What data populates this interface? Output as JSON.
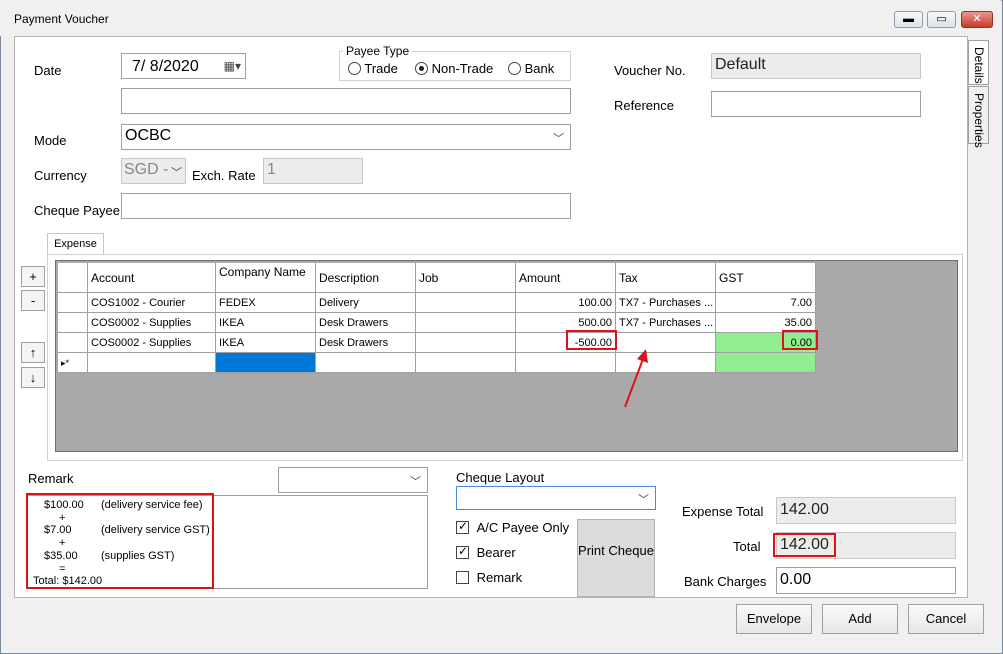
{
  "window": {
    "title": "Payment Voucher",
    "min_glyph": "▬",
    "max_glyph": "▭",
    "close_glyph": "✕"
  },
  "side_tabs": {
    "details": "Details",
    "properties": "Properties"
  },
  "form": {
    "date_label": "Date",
    "date_value": "7/  8/2020",
    "payee_type": {
      "legend": "Payee Type",
      "options": [
        "Trade",
        "Non-Trade",
        "Bank"
      ],
      "selected": "Non-Trade"
    },
    "voucher_label": "Voucher No.",
    "voucher_value": "Default",
    "reference_label": "Reference",
    "reference_value": "",
    "mode_label": "Mode",
    "mode_value": "OCBC",
    "currency_label": "Currency",
    "currency_value": "SGD -",
    "exch_label": "Exch. Rate",
    "exch_value": "1",
    "cheque_payee_label": "Cheque Payee",
    "cheque_payee_value": ""
  },
  "expense_tab": {
    "label": "Expense"
  },
  "side_buttons": {
    "add": "+",
    "remove": "-",
    "up": "↑",
    "down": "↓"
  },
  "grid": {
    "columns": [
      "Account",
      "Company Name",
      "Description",
      "Job",
      "Amount",
      "Tax",
      "GST"
    ],
    "rows": [
      {
        "account": "COS1002 - Courier",
        "company": "FEDEX",
        "description": "Delivery",
        "job": "",
        "amount": "100.00",
        "tax": "TX7 - Purchases ...",
        "gst": "7.00"
      },
      {
        "account": "COS0002 - Supplies",
        "company": "IKEA",
        "description": "Desk Drawers",
        "job": "",
        "amount": "500.00",
        "tax": "TX7 - Purchases ...",
        "gst": "35.00"
      },
      {
        "account": "COS0002 - Supplies",
        "company": "IKEA",
        "description": "Desk Drawers",
        "job": "",
        "amount": "-500.00",
        "tax": "",
        "gst": "0.00"
      }
    ],
    "new_row_marker": "▸*"
  },
  "remark": {
    "label": "Remark",
    "lines": [
      "$100.00",
      "(delivery service fee)",
      "+",
      "$7.00",
      "(delivery service GST)",
      "+",
      "$35.00",
      "(supplies GST)",
      "=",
      "Total: $142.00"
    ]
  },
  "cheque": {
    "layout_label": "Cheque Layout",
    "ac_payee_label": "A/C Payee Only",
    "bearer_label": "Bearer",
    "remark_label": "Remark",
    "print_label": "Print Cheque"
  },
  "totals": {
    "expense_total_label": "Expense Total",
    "expense_total_value": "142.00",
    "total_label": "Total",
    "total_value": "142.00",
    "bank_charges_label": "Bank Charges",
    "bank_charges_value": "0.00"
  },
  "buttons": {
    "envelope": "Envelope",
    "add": "Add",
    "cancel": "Cancel"
  },
  "colors": {
    "highlight_red": "#e0101a",
    "gst_green": "#90ee90",
    "selected_blue": "#0078d7",
    "grid_bg": "#a9a9a9"
  }
}
